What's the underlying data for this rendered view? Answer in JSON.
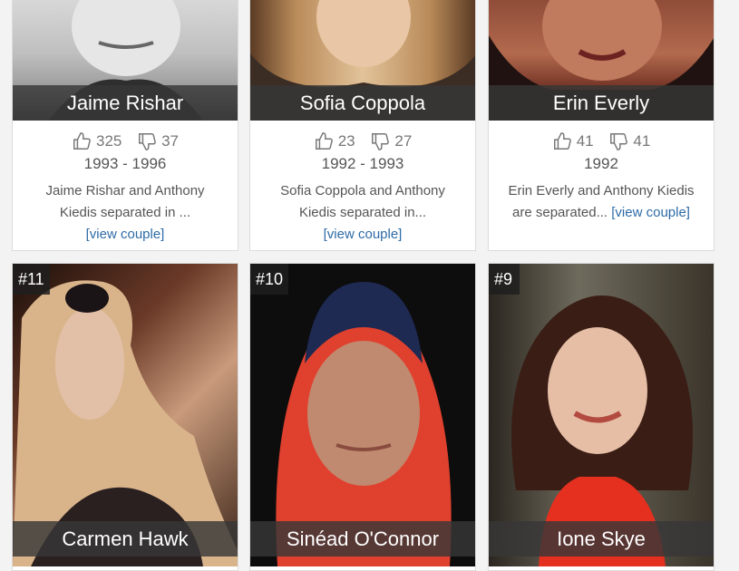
{
  "cards_top": [
    {
      "name": "Jaime Rishar",
      "likes": "325",
      "dislikes": "37",
      "years": "1993 - 1996",
      "desc_line1": "Jaime Rishar and Anthony",
      "desc_line2": "Kiedis separated in ...",
      "link": "[view couple]"
    },
    {
      "name": "Sofia Coppola",
      "likes": "23",
      "dislikes": "27",
      "years": "1992 - 1993",
      "desc_line1": "Sofia Coppola and Anthony",
      "desc_line2": "Kiedis separated in...",
      "link": "[view couple]"
    },
    {
      "name": "Erin Everly",
      "likes": "41",
      "dislikes": "41",
      "years": "1992",
      "desc_line1": "Erin Everly and Anthony Kiedis",
      "desc_line2": "are separated...",
      "link": "[view couple]"
    }
  ],
  "cards_bottom": [
    {
      "rank": "#11",
      "name": "Carmen Hawk"
    },
    {
      "rank": "#10",
      "name": "Sinéad O'Connor"
    },
    {
      "rank": "#9",
      "name": "Ione Skye"
    }
  ],
  "icons": {
    "like": "thumbs-up-icon",
    "dislike": "thumbs-down-icon"
  },
  "colors": {
    "link": "#2e6ba6",
    "name_bar": "#373737",
    "text": "#555555"
  }
}
